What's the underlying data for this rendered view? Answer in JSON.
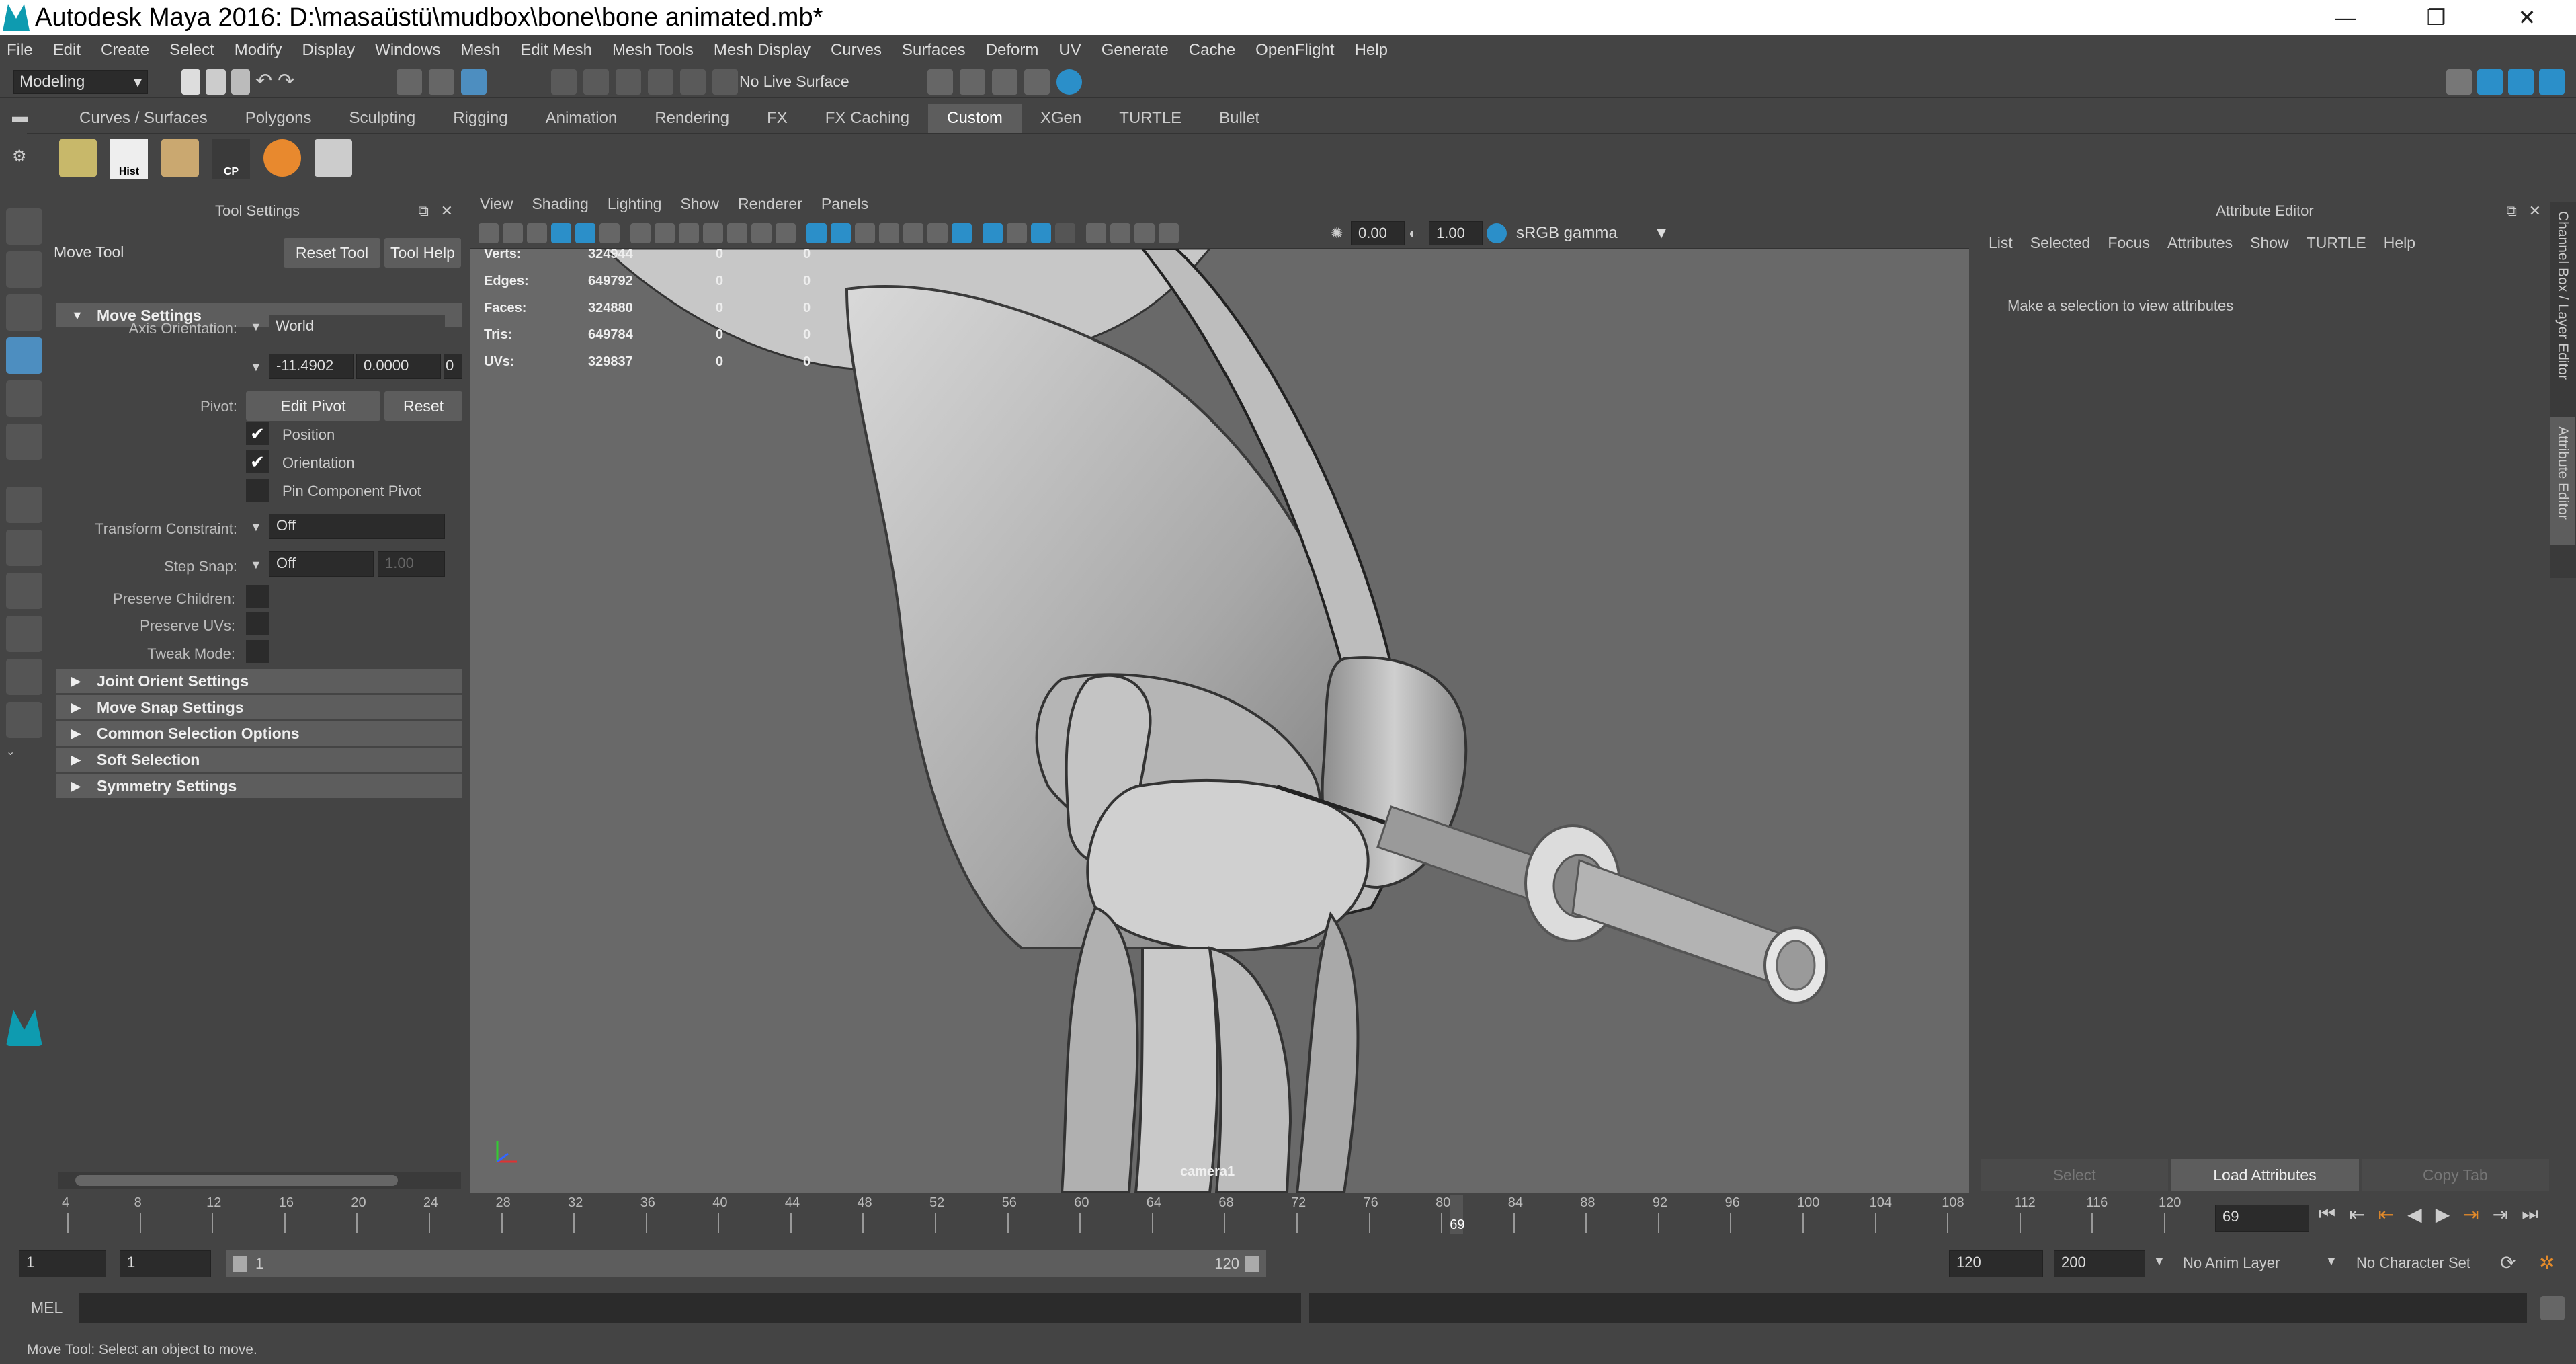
{
  "window": {
    "title": "Autodesk Maya 2016: D:\\masaüstü\\mudbox\\bone\\bone animated.mb*",
    "minimize": "—",
    "maximize": "❐",
    "close": "✕"
  },
  "menus": [
    "File",
    "Edit",
    "Create",
    "Select",
    "Modify",
    "Display",
    "Windows",
    "Mesh",
    "Edit Mesh",
    "Mesh Tools",
    "Mesh Display",
    "Curves",
    "Surfaces",
    "Deform",
    "UV",
    "Generate",
    "Cache",
    "OpenFlight",
    "Help"
  ],
  "statusline": {
    "menuset": "Modeling",
    "live_surface": "No Live Surface"
  },
  "shelf": {
    "tabs": [
      "Curves / Surfaces",
      "Polygons",
      "Sculpting",
      "Rigging",
      "Animation",
      "Rendering",
      "FX",
      "FX Caching",
      "Custom",
      "XGen",
      "TURTLE",
      "Bullet"
    ],
    "active_tab": "Custom",
    "hist_label": "Hist",
    "cp_label": "CP"
  },
  "tool_settings": {
    "panel_title": "Tool Settings",
    "tool_name": "Move Tool",
    "reset_tool": "Reset Tool",
    "tool_help": "Tool Help",
    "move_settings": "Move Settings",
    "axis_orientation_label": "Axis Orientation:",
    "axis_orientation": "World",
    "value_x": "-11.4902",
    "value_y": "0.0000",
    "value_z": "0",
    "pivot_label": "Pivot:",
    "edit_pivot": "Edit Pivot",
    "reset": "Reset",
    "position": "Position",
    "orientation": "Orientation",
    "pin_component_pivot": "Pin Component Pivot",
    "transform_constraint_label": "Transform Constraint:",
    "transform_constraint": "Off",
    "step_snap_label": "Step Snap:",
    "step_snap": "Off",
    "step_snap_value": "1.00",
    "preserve_children": "Preserve Children:",
    "preserve_uvs": "Preserve UVs:",
    "tweak_mode": "Tweak Mode:",
    "frames": [
      "Joint Orient Settings",
      "Move Snap Settings",
      "Common Selection Options",
      "Soft Selection",
      "Symmetry Settings"
    ]
  },
  "viewport": {
    "menus": [
      "View",
      "Shading",
      "Lighting",
      "Show",
      "Renderer",
      "Panels"
    ],
    "exposure": "0.00",
    "gamma": "1.00",
    "color_space": "sRGB gamma",
    "camera": "camera1",
    "hud": [
      {
        "label": "Verts:",
        "total": "324944",
        "sel": "0",
        "comp": "0"
      },
      {
        "label": "Edges:",
        "total": "649792",
        "sel": "0",
        "comp": "0"
      },
      {
        "label": "Faces:",
        "total": "324880",
        "sel": "0",
        "comp": "0"
      },
      {
        "label": "Tris:",
        "total": "649784",
        "sel": "0",
        "comp": "0"
      },
      {
        "label": "UVs:",
        "total": "329837",
        "sel": "0",
        "comp": "0"
      }
    ]
  },
  "attribute_editor": {
    "title": "Attribute Editor",
    "tabs": [
      "List",
      "Selected",
      "Focus",
      "Attributes",
      "Show",
      "TURTLE",
      "Help"
    ],
    "message": "Make a selection to view attributes",
    "select": "Select",
    "load_attributes": "Load Attributes",
    "copy_tab": "Copy Tab",
    "side_tabs": [
      "Channel Box / Layer Editor",
      "Attribute Editor"
    ]
  },
  "time_slider": {
    "ticks": [
      "4",
      "8",
      "12",
      "16",
      "20",
      "24",
      "28",
      "32",
      "36",
      "40",
      "44",
      "48",
      "52",
      "56",
      "60",
      "64",
      "68",
      "72",
      "76",
      "80",
      "84",
      "88",
      "92",
      "96",
      "100",
      "104",
      "108",
      "112",
      "116",
      "120"
    ],
    "current_frame_marker": "69",
    "current_frame": "69",
    "current_frame_fraction": 0.575
  },
  "range_slider": {
    "start": "1",
    "start2": "1",
    "range_start": "1",
    "range_end": "120",
    "end": "120",
    "end2": "200",
    "anim_layer": "No Anim Layer",
    "character_set": "No Character Set"
  },
  "command_line": {
    "language": "MEL"
  },
  "help_line": "Move Tool: Select an object to move.",
  "colors": {
    "ui_bg": "#444444",
    "field_bg": "#2b2b2b",
    "active_tool": "#4d8ec0",
    "viewport_bg": "#696969",
    "maya_teal": "#0e9bb0"
  }
}
